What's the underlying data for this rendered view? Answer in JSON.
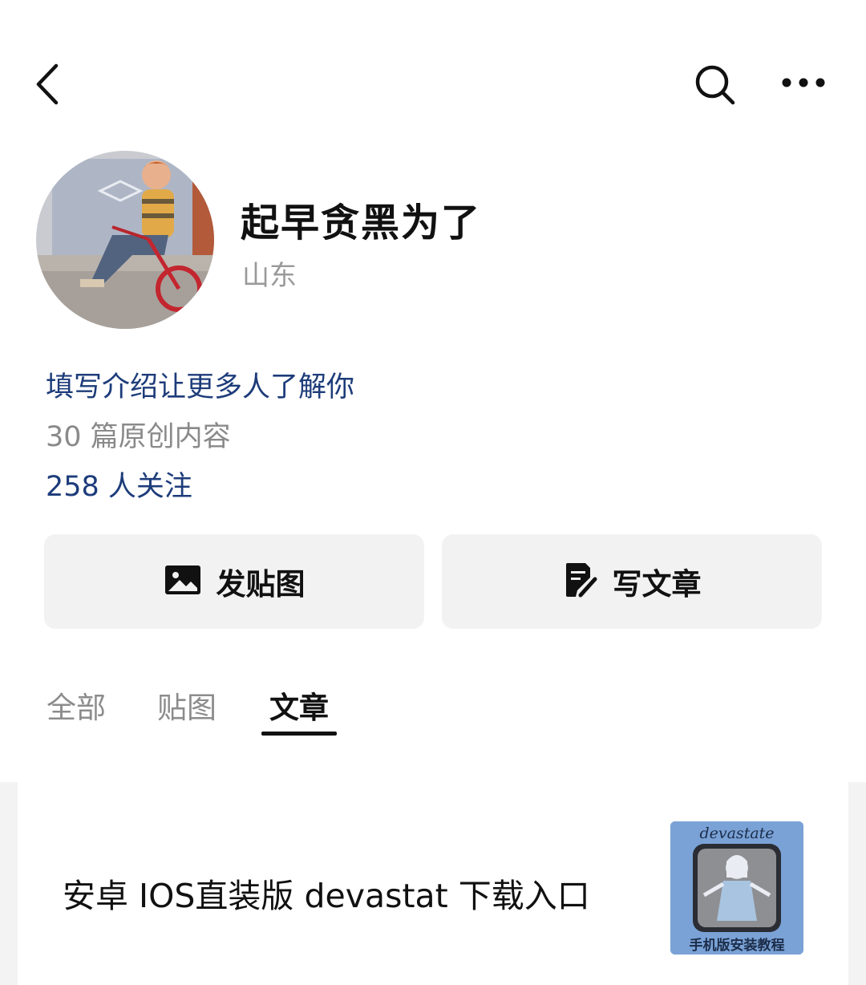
{
  "header": {
    "back_icon": "chevron-left-icon",
    "search_icon": "search-icon",
    "more_icon": "more-horizontal-icon"
  },
  "profile": {
    "name": "起早贪黑为了",
    "region": "山东",
    "intro_prompt": "填写介绍让更多人了解你",
    "original_count": "30 篇原创内容",
    "followers": "258 人关注"
  },
  "actions": {
    "post_image": {
      "label": "发贴图",
      "icon": "image-icon"
    },
    "write_article": {
      "label": "写文章",
      "icon": "edit-note-icon"
    }
  },
  "tabs": [
    {
      "label": "全部",
      "active": false
    },
    {
      "label": "贴图",
      "active": false
    },
    {
      "label": "文章",
      "active": true
    }
  ],
  "articles": [
    {
      "title": "安卓 IOS直装版 devastat 下载入口",
      "thumbnail": {
        "top_text": "devastate",
        "bottom_text": "手机版安装教程"
      }
    }
  ],
  "colors": {
    "link_blue": "#1d3c7a",
    "muted_gray": "#8a8a8a",
    "button_bg": "#f2f2f2"
  }
}
